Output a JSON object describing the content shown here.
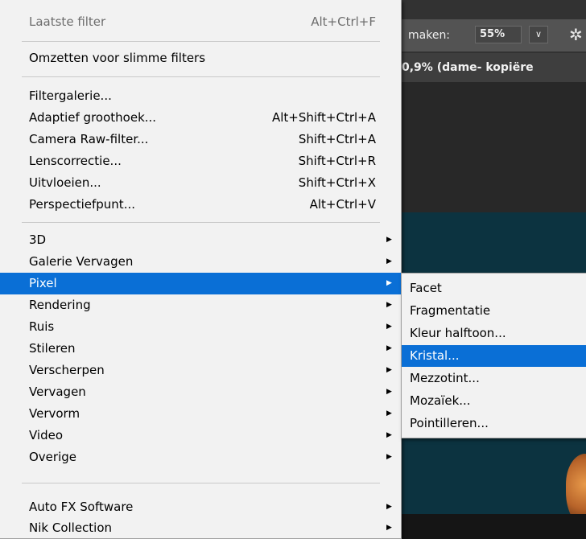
{
  "app": {
    "options_bar": {
      "label": "maken:",
      "zoom": "55%",
      "zoom_arrow": "∨",
      "gear": "✲"
    },
    "doc_tab": "0,9% (dame- kopiëre"
  },
  "filter_menu": {
    "last_filter": {
      "label": "Laatste filter",
      "shortcut": "Alt+Ctrl+F"
    },
    "convert_smart": {
      "label": "Omzetten voor slimme filters"
    },
    "filter_gallery": {
      "label": "Filtergalerie..."
    },
    "adaptive_wide": {
      "label": "Adaptief groothoek...",
      "shortcut": "Alt+Shift+Ctrl+A"
    },
    "camera_raw": {
      "label": "Camera Raw-filter...",
      "shortcut": "Shift+Ctrl+A"
    },
    "lens_correction": {
      "label": "Lenscorrectie...",
      "shortcut": "Shift+Ctrl+R"
    },
    "liquify": {
      "label": "Uitvloeien...",
      "shortcut": "Shift+Ctrl+X"
    },
    "vanishing_point": {
      "label": "Perspectiefpunt...",
      "shortcut": "Alt+Ctrl+V"
    },
    "groups": [
      {
        "label": "3D"
      },
      {
        "label": "Galerie Vervagen"
      },
      {
        "label": "Pixel"
      },
      {
        "label": "Rendering"
      },
      {
        "label": "Ruis"
      },
      {
        "label": "Stileren"
      },
      {
        "label": "Verscherpen"
      },
      {
        "label": "Vervagen"
      },
      {
        "label": "Vervorm"
      },
      {
        "label": "Video"
      },
      {
        "label": "Overige"
      }
    ],
    "plugins": [
      {
        "label": "Auto FX Software"
      },
      {
        "label": "Nik Collection"
      }
    ],
    "submenu_arrow": "▶"
  },
  "pixel_submenu": {
    "items": [
      {
        "label": "Facet"
      },
      {
        "label": "Fragmentatie"
      },
      {
        "label": "Kleur halftoon..."
      },
      {
        "label": "Kristal..."
      },
      {
        "label": "Mezzotint..."
      },
      {
        "label": "Mozaïek..."
      },
      {
        "label": "Pointilleren..."
      }
    ]
  },
  "colors": {
    "menu_bg": "#f2f2f2",
    "highlight": "#0a6fd6",
    "canvas": "#0c3340",
    "options_bar": "#535353"
  }
}
